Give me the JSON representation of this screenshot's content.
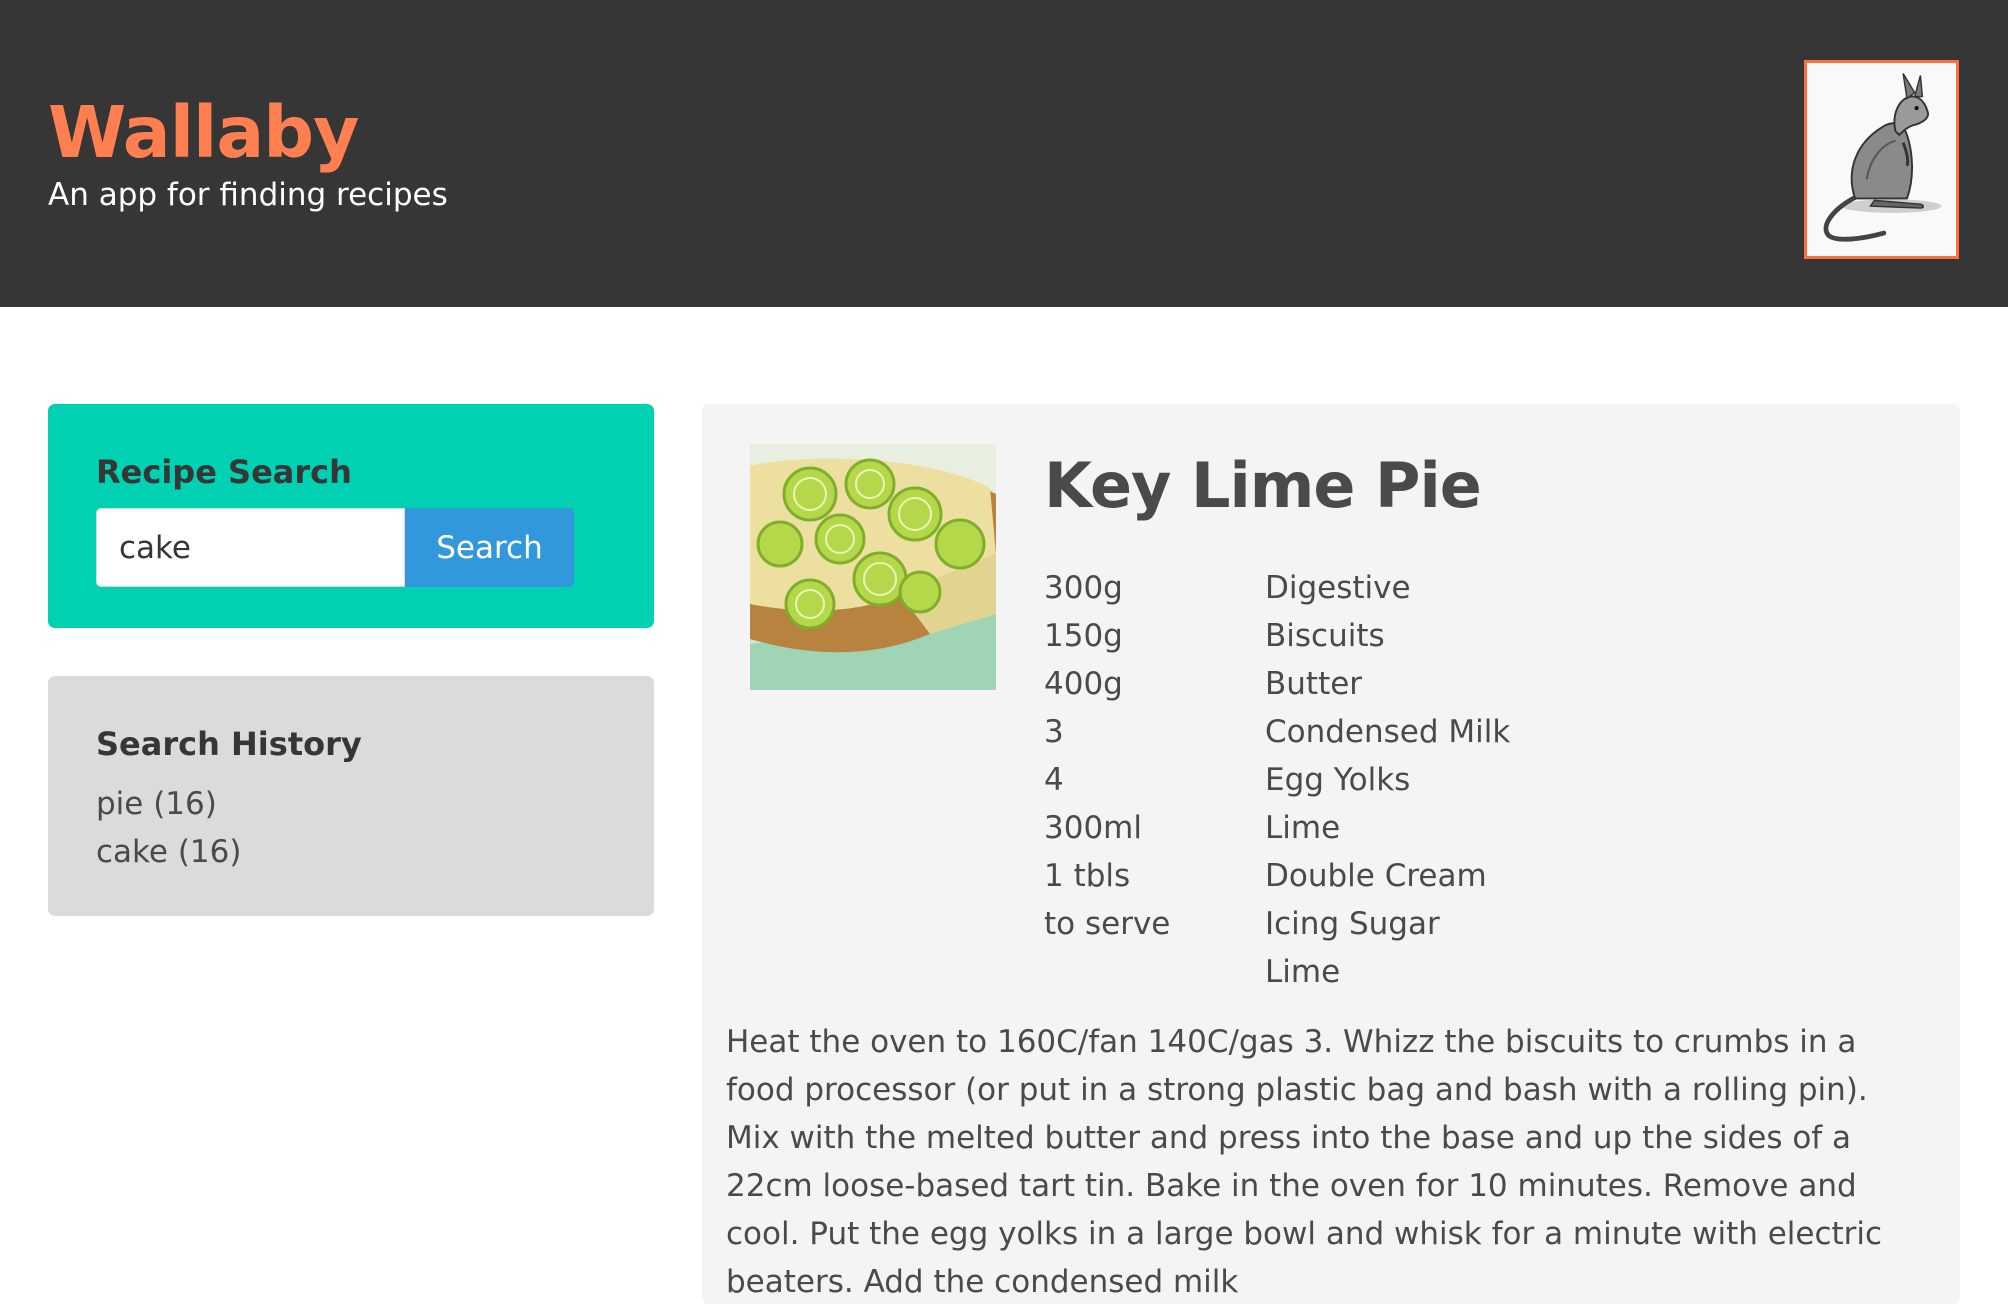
{
  "header": {
    "title": "Wallaby",
    "subtitle": "An app for finding recipes",
    "logo": "wallaby-illustration"
  },
  "search": {
    "heading": "Recipe Search",
    "input_value": "cake",
    "button_label": "Search"
  },
  "history": {
    "heading": "Search History",
    "items": [
      "pie (16)",
      "cake (16)"
    ]
  },
  "recipe": {
    "title": "Key Lime Pie",
    "image": "key-lime-pie-photo",
    "quantities": [
      "300g",
      "150g",
      "400g",
      "3",
      "4",
      "300ml",
      "1 tbls",
      "to serve",
      ""
    ],
    "ingredients": [
      "Digestive",
      "Biscuits",
      "Butter",
      "Condensed Milk",
      "Egg Yolks",
      "Lime",
      "Double Cream",
      "Icing Sugar",
      "Lime"
    ],
    "method": "Heat the oven to 160C/fan 140C/gas 3. Whizz the biscuits to crumbs in a food processor (or put in a strong plastic bag and bash with a rolling pin). Mix with the melted butter and press into the base and up the sides of a 22cm loose-based tart tin. Bake in the oven for 10 minutes. Remove and cool. Put the egg yolks in a large bowl and whisk for a minute with electric beaters. Add the condensed milk"
  },
  "colors": {
    "header_bg": "#363636",
    "brand": "#ff7f50",
    "search_panel": "#00d1b2",
    "button": "#3298dc",
    "history_panel": "#dbdbdb",
    "card_bg": "#f4f4f4"
  }
}
